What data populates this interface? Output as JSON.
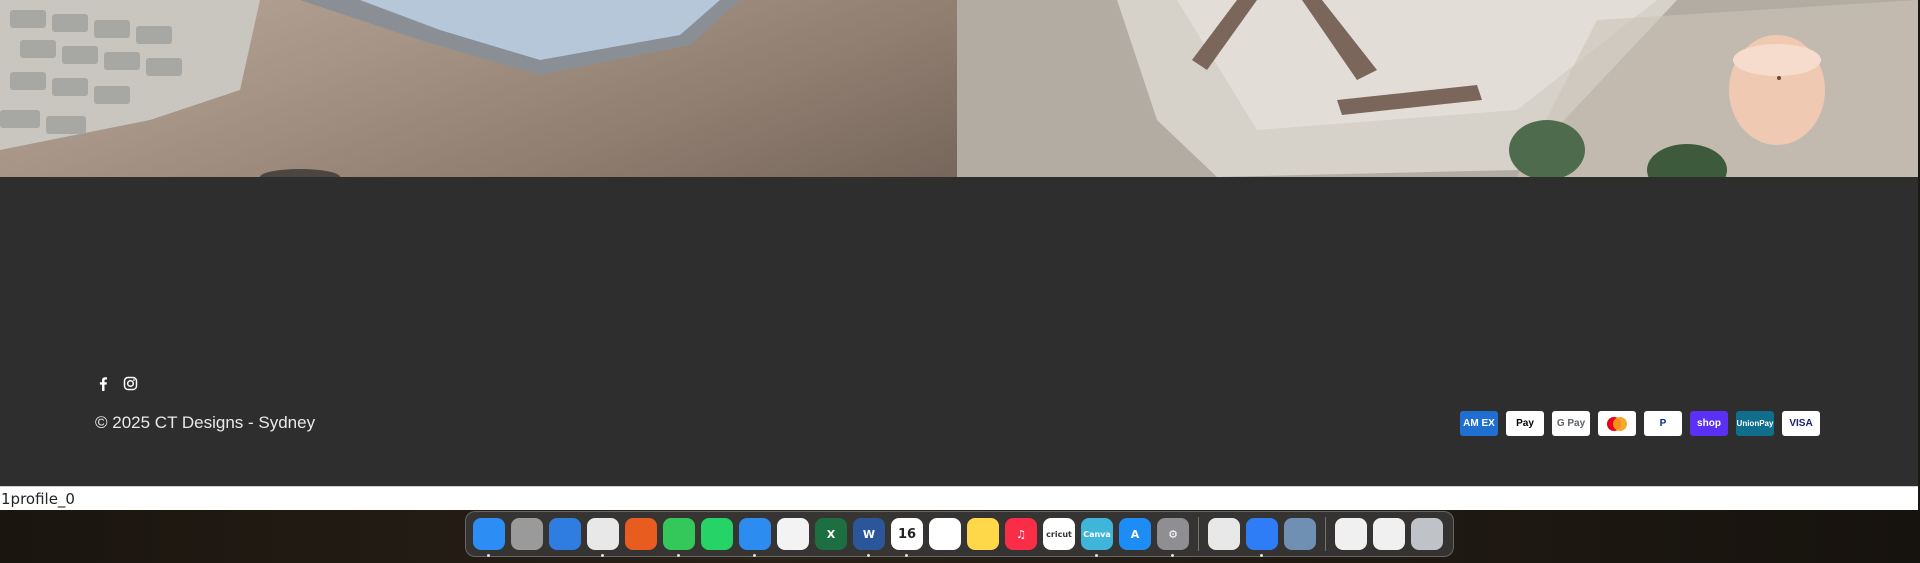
{
  "footer": {
    "copyright": "© 2025 CT Designs - Sydney",
    "social": [
      "facebook-icon",
      "instagram-icon"
    ],
    "payments": [
      {
        "name": "amex",
        "label": "AM EX",
        "bg": "#1f6fd1",
        "fg": "#ffffff"
      },
      {
        "name": "apple-pay",
        "label": " Pay",
        "bg": "#ffffff",
        "fg": "#000000"
      },
      {
        "name": "google-pay",
        "label": "G Pay",
        "bg": "#ffffff",
        "fg": "#5f6368"
      },
      {
        "name": "mastercard",
        "label": "",
        "bg": "#ffffff",
        "fg": "#000000"
      },
      {
        "name": "paypal",
        "label": "P",
        "bg": "#ffffff",
        "fg": "#003087"
      },
      {
        "name": "shop-pay",
        "label": "shop",
        "bg": "#5a31f4",
        "fg": "#ffffff"
      },
      {
        "name": "unionpay",
        "label": "UnionPay",
        "bg": "#0e6e8c",
        "fg": "#ffffff"
      },
      {
        "name": "visa",
        "label": "VISA",
        "bg": "#ffffff",
        "fg": "#1a1f71"
      }
    ]
  },
  "statusbar": {
    "text": "1profile_0"
  },
  "dock": {
    "apps": [
      {
        "name": "finder",
        "bg": "#2c8df5",
        "label": "",
        "running": true
      },
      {
        "name": "launchpad",
        "bg": "#9a9a9a",
        "label": "",
        "running": false
      },
      {
        "name": "safari",
        "bg": "#2f7de1",
        "label": "",
        "running": false
      },
      {
        "name": "chrome",
        "bg": "#e8e8e8",
        "label": "",
        "running": true
      },
      {
        "name": "firefox",
        "bg": "#e85d1f",
        "label": "",
        "running": false
      },
      {
        "name": "messages",
        "bg": "#34c759",
        "label": "",
        "running": true
      },
      {
        "name": "whatsapp",
        "bg": "#25d366",
        "label": "",
        "running": false
      },
      {
        "name": "mail",
        "bg": "#2d8cf0",
        "label": "",
        "running": true
      },
      {
        "name": "photos",
        "bg": "#f3f3f3",
        "label": "",
        "running": false
      },
      {
        "name": "excel",
        "bg": "#1d6f42",
        "label": "X",
        "running": false
      },
      {
        "name": "word",
        "bg": "#2b579a",
        "label": "W",
        "running": true
      },
      {
        "name": "calendar",
        "bg": "#ffffff",
        "label": "16",
        "running": true
      },
      {
        "name": "reminders",
        "bg": "#ffffff",
        "label": "",
        "running": false
      },
      {
        "name": "notes",
        "bg": "#ffd84a",
        "label": "",
        "running": false
      },
      {
        "name": "music",
        "bg": "#fa2d48",
        "label": "♫",
        "running": false
      },
      {
        "name": "cricut",
        "bg": "#ffffff",
        "label": "cricut",
        "running": false
      },
      {
        "name": "canva",
        "bg": "#3fb6d9",
        "label": "Canva",
        "running": true
      },
      {
        "name": "app-store",
        "bg": "#1e8cf5",
        "label": "A",
        "running": false
      },
      {
        "name": "system-settings",
        "bg": "#8e8e93",
        "label": "⚙",
        "running": true
      },
      {
        "name": "acrobat",
        "bg": "#e8e8e8",
        "label": "",
        "running": false
      },
      {
        "name": "keynote",
        "bg": "#2e7cf6",
        "label": "",
        "running": true
      },
      {
        "name": "preview",
        "bg": "#6f8fb3",
        "label": "",
        "running": false
      },
      {
        "name": "recent-doc-1",
        "bg": "#f0f0f0",
        "label": "",
        "running": false
      },
      {
        "name": "recent-doc-2",
        "bg": "#f0f0f0",
        "label": "",
        "running": false
      },
      {
        "name": "trash",
        "bg": "#bfc2c6",
        "label": "",
        "running": false
      }
    ]
  }
}
